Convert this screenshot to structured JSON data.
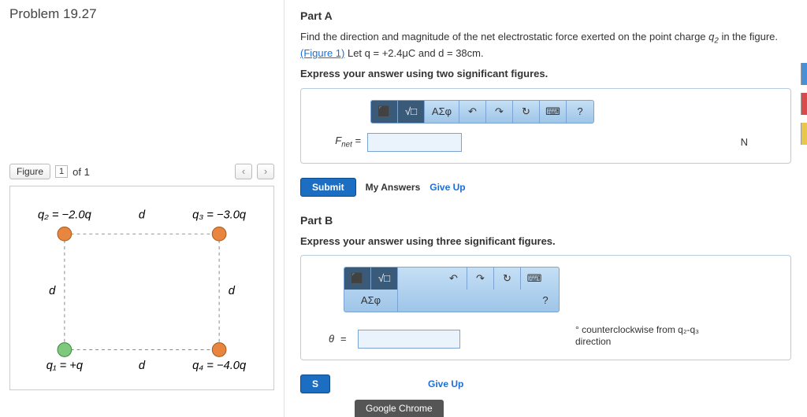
{
  "problem_title": "Problem 19.27",
  "figure_nav": {
    "label": "Figure",
    "selector": "1",
    "of": "of 1",
    "prev": "‹",
    "next": "›"
  },
  "figure": {
    "q2": "q₂ = −2.0q",
    "q3": "q₃ = −3.0q",
    "q1": "q₁ = +q",
    "q4": "q₄ = −4.0q",
    "d": "d"
  },
  "partA": {
    "title": "Part A",
    "prompt_pre": "Find the direction and magnitude of the net electrostatic force exerted on the point charge ",
    "prompt_q": "q",
    "prompt_sub": "2",
    "prompt_mid": " in the figure.",
    "fig_link": "(Figure 1)",
    "prompt_let": " Let q = +2.4μC and d = 38cm.",
    "express": "Express your answer using two significant figures.",
    "tb": {
      "sel": "⬛",
      "tmpl": "√□",
      "greek": "ΑΣφ",
      "undo": "↶",
      "redo": "↷",
      "reset": "↻",
      "kb": "⌨",
      "help": "?"
    },
    "ans_label": "Fₙₑₜ =",
    "unit": "N",
    "submit": "Submit",
    "my_answers": "My Answers",
    "giveup": "Give Up"
  },
  "partB": {
    "title": "Part B",
    "express": "Express your answer using three significant figures.",
    "tb": {
      "sel": "⬛",
      "tmpl": "√□",
      "greek": "ΑΣφ",
      "undo": "↶",
      "redo": "↷",
      "reset": "↻",
      "kb": "⌨",
      "help": "?"
    },
    "theta": "θ",
    "eq": "=",
    "unit1": "° counterclockwise from q₂-q₃",
    "unit2": "direction",
    "submit": "S",
    "giveup": "Give Up"
  },
  "chrome": "Google Chrome"
}
